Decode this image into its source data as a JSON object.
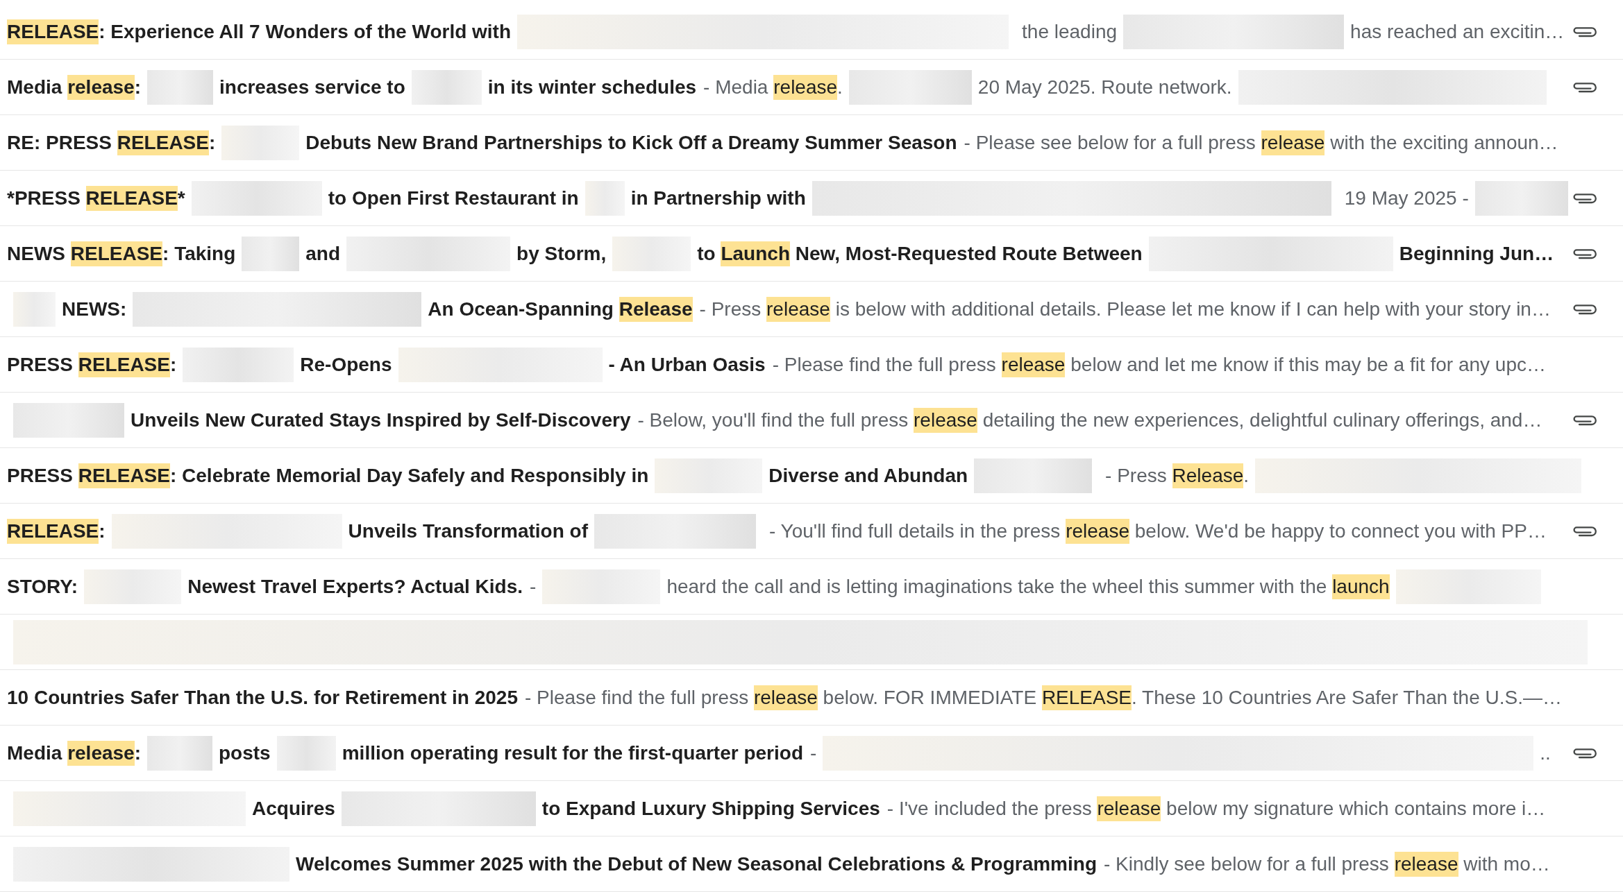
{
  "rows": [
    {
      "attachment": true,
      "subject": [
        {
          "kind": "highlight",
          "text": "RELEASE"
        },
        {
          "kind": "text",
          "text": ": Experience All 7 Wonders of the World with"
        },
        {
          "kind": "redacted"
        }
      ],
      "snippet": [
        {
          "kind": "text",
          "text": "the leading"
        },
        {
          "kind": "redacted"
        },
        {
          "kind": "text",
          "text": "has reached an excitin…"
        }
      ]
    },
    {
      "attachment": true,
      "subject": [
        {
          "kind": "text",
          "text": "Media "
        },
        {
          "kind": "highlight",
          "text": "release"
        },
        {
          "kind": "text",
          "text": ":"
        },
        {
          "kind": "redacted"
        },
        {
          "kind": "text",
          "text": "increases service to"
        },
        {
          "kind": "redacted"
        },
        {
          "kind": "text",
          "text": "in its winter schedules"
        }
      ],
      "snippet": [
        {
          "kind": "text",
          "text": "- Media "
        },
        {
          "kind": "highlight",
          "text": "release"
        },
        {
          "kind": "text",
          "text": "."
        },
        {
          "kind": "redacted"
        },
        {
          "kind": "text",
          "text": "20 May 2025. Route network."
        },
        {
          "kind": "redacted"
        }
      ]
    },
    {
      "attachment": false,
      "subject": [
        {
          "kind": "text",
          "text": "RE: PRESS "
        },
        {
          "kind": "highlight",
          "text": "RELEASE"
        },
        {
          "kind": "text",
          "text": ":"
        },
        {
          "kind": "redacted"
        },
        {
          "kind": "text",
          "text": "Debuts New Brand Partnerships to Kick Off a Dreamy Summer Season"
        }
      ],
      "snippet": [
        {
          "kind": "text",
          "text": "- Please see below for a full press "
        },
        {
          "kind": "highlight",
          "text": "release"
        },
        {
          "kind": "text",
          "text": " with the exciting announ…"
        }
      ]
    },
    {
      "attachment": true,
      "subject": [
        {
          "kind": "text",
          "text": "*PRESS "
        },
        {
          "kind": "highlight",
          "text": "RELEASE"
        },
        {
          "kind": "text",
          "text": "*"
        },
        {
          "kind": "redacted"
        },
        {
          "kind": "text",
          "text": "to Open First Restaurant in"
        },
        {
          "kind": "redacted"
        },
        {
          "kind": "text",
          "text": "in Partnership with"
        },
        {
          "kind": "redacted"
        }
      ],
      "snippet": [
        {
          "kind": "text",
          "text": "19 May 2025 -"
        },
        {
          "kind": "redacted"
        }
      ]
    },
    {
      "attachment": true,
      "subject": [
        {
          "kind": "text",
          "text": "NEWS "
        },
        {
          "kind": "highlight",
          "text": "RELEASE"
        },
        {
          "kind": "text",
          "text": ": Taking"
        },
        {
          "kind": "redacted"
        },
        {
          "kind": "text",
          "text": "and"
        },
        {
          "kind": "redacted"
        },
        {
          "kind": "text",
          "text": "by Storm,"
        },
        {
          "kind": "redacted"
        },
        {
          "kind": "text",
          "text": "to "
        },
        {
          "kind": "highlight",
          "text": "Launch"
        },
        {
          "kind": "text",
          "text": " New, Most-Requested Route Between"
        },
        {
          "kind": "redacted"
        },
        {
          "kind": "text",
          "text": "Beginning Jun…"
        }
      ]
    },
    {
      "attachment": true,
      "subject": [
        {
          "kind": "redacted"
        },
        {
          "kind": "text",
          "text": "NEWS:"
        },
        {
          "kind": "redacted"
        },
        {
          "kind": "text",
          "text": "An Ocean-Spanning "
        },
        {
          "kind": "highlight",
          "text": "Release"
        }
      ],
      "snippet": [
        {
          "kind": "text",
          "text": "- Press "
        },
        {
          "kind": "highlight",
          "text": "release"
        },
        {
          "kind": "text",
          "text": " is below with additional details. Please let me know if I can help with your story in…"
        }
      ]
    },
    {
      "attachment": false,
      "subject": [
        {
          "kind": "text",
          "text": "PRESS "
        },
        {
          "kind": "highlight",
          "text": "RELEASE"
        },
        {
          "kind": "text",
          "text": ":"
        },
        {
          "kind": "redacted"
        },
        {
          "kind": "text",
          "text": "Re-Opens"
        },
        {
          "kind": "redacted"
        },
        {
          "kind": "text",
          "text": "- An Urban Oasis"
        }
      ],
      "snippet": [
        {
          "kind": "text",
          "text": "- Please find the full press "
        },
        {
          "kind": "highlight",
          "text": "release"
        },
        {
          "kind": "text",
          "text": " below and let me know if this may be a fit for any upc…"
        }
      ]
    },
    {
      "attachment": true,
      "subject": [
        {
          "kind": "redacted"
        },
        {
          "kind": "text",
          "text": "Unveils New Curated Stays Inspired by Self-Discovery"
        }
      ],
      "snippet": [
        {
          "kind": "text",
          "text": "- Below, you'll find the full press "
        },
        {
          "kind": "highlight",
          "text": "release"
        },
        {
          "kind": "text",
          "text": " detailing the new experiences, delightful culinary offerings, and…"
        }
      ]
    },
    {
      "attachment": false,
      "subject": [
        {
          "kind": "text",
          "text": "PRESS "
        },
        {
          "kind": "highlight",
          "text": "RELEASE"
        },
        {
          "kind": "text",
          "text": ": Celebrate Memorial Day Safely and Responsibly in"
        },
        {
          "kind": "redacted"
        },
        {
          "kind": "text",
          "text": "Diverse and Abundan"
        },
        {
          "kind": "redacted"
        }
      ],
      "snippet": [
        {
          "kind": "text",
          "text": "- Press "
        },
        {
          "kind": "highlight",
          "text": "Release"
        },
        {
          "kind": "text",
          "text": "."
        },
        {
          "kind": "redacted"
        }
      ]
    },
    {
      "attachment": true,
      "subject": [
        {
          "kind": "highlight",
          "text": "RELEASE"
        },
        {
          "kind": "text",
          "text": ":"
        },
        {
          "kind": "redacted"
        },
        {
          "kind": "text",
          "text": "Unveils Transformation of"
        },
        {
          "kind": "redacted"
        }
      ],
      "snippet": [
        {
          "kind": "text",
          "text": "- You'll find full details in the press "
        },
        {
          "kind": "highlight",
          "text": "release"
        },
        {
          "kind": "text",
          "text": " below. We'd be happy to connect you with PP…"
        }
      ]
    },
    {
      "attachment": false,
      "subject": [
        {
          "kind": "text",
          "text": "STORY:"
        },
        {
          "kind": "redacted"
        },
        {
          "kind": "text",
          "text": "Newest Travel Experts? Actual Kids."
        }
      ],
      "snippet": [
        {
          "kind": "text",
          "text": "-"
        },
        {
          "kind": "redacted"
        },
        {
          "kind": "text",
          "text": "heard the call and is letting imaginations take the wheel this summer with the "
        },
        {
          "kind": "highlight",
          "text": "launch"
        },
        {
          "kind": "redacted"
        }
      ]
    },
    {
      "attachment": false,
      "subject": [
        {
          "kind": "redacted"
        }
      ]
    },
    {
      "attachment": false,
      "subject": [
        {
          "kind": "text",
          "text": "10 Countries Safer Than the U.S. for Retirement in 2025"
        }
      ],
      "snippet": [
        {
          "kind": "text",
          "text": "- Please find the full press "
        },
        {
          "kind": "highlight",
          "text": "release"
        },
        {
          "kind": "text",
          "text": " below. FOR IMMEDIATE "
        },
        {
          "kind": "highlight",
          "text": "RELEASE"
        },
        {
          "kind": "text",
          "text": ". These 10 Countries Are Safer Than the U.S.—…"
        }
      ]
    },
    {
      "attachment": true,
      "subject": [
        {
          "kind": "text",
          "text": "Media "
        },
        {
          "kind": "highlight",
          "text": "release"
        },
        {
          "kind": "text",
          "text": ":"
        },
        {
          "kind": "redacted"
        },
        {
          "kind": "text",
          "text": "posts"
        },
        {
          "kind": "redacted"
        },
        {
          "kind": "text",
          "text": "million operating result for the first-quarter period"
        }
      ],
      "snippet": [
        {
          "kind": "text",
          "text": "-"
        },
        {
          "kind": "redacted"
        },
        {
          "kind": "text",
          "text": ".."
        }
      ]
    },
    {
      "attachment": false,
      "subject": [
        {
          "kind": "redacted"
        },
        {
          "kind": "text",
          "text": "Acquires"
        },
        {
          "kind": "redacted"
        },
        {
          "kind": "text",
          "text": "to Expand Luxury Shipping Services"
        }
      ],
      "snippet": [
        {
          "kind": "text",
          "text": "- I've included the press "
        },
        {
          "kind": "highlight",
          "text": "release"
        },
        {
          "kind": "text",
          "text": " below my signature which contains more i…"
        }
      ]
    },
    {
      "attachment": false,
      "subject": [
        {
          "kind": "redacted"
        },
        {
          "kind": "text",
          "text": "Welcomes Summer 2025 with the Debut of New Seasonal Celebrations & Programming"
        }
      ],
      "snippet": [
        {
          "kind": "text",
          "text": "- Kindly see below for a full press "
        },
        {
          "kind": "highlight",
          "text": "release"
        },
        {
          "kind": "text",
          "text": " with mo…"
        }
      ]
    }
  ]
}
